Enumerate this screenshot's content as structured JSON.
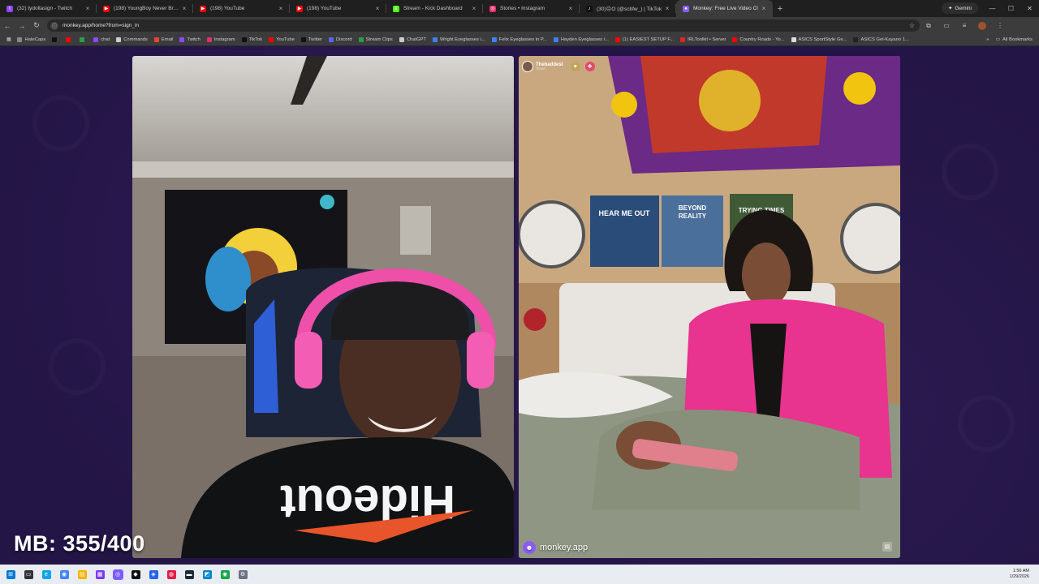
{
  "browser": {
    "tabs": [
      {
        "title": "(32) tydollasign - Twitch",
        "color": "#9146ff",
        "glyph": "t"
      },
      {
        "title": "(198) YoungBoy Never Broke A",
        "color": "#ff0000",
        "glyph": "▶"
      },
      {
        "title": "(198) YouTube",
        "color": "#ff0000",
        "glyph": "▶"
      },
      {
        "title": "(198) YouTube",
        "color": "#ff0000",
        "glyph": "▶"
      },
      {
        "title": "Stream - Kick Dashboard",
        "color": "#53fc18",
        "glyph": "k"
      },
      {
        "title": "Stories • Instagram",
        "color": "#e1306c",
        "glyph": "◎"
      },
      {
        "title": "(30)☹O (@scbfw_) | TikTok",
        "color": "#111111",
        "glyph": "♪"
      },
      {
        "title": "Monkey: Free Live Video Cl",
        "color": "#8b5cf6",
        "glyph": "●",
        "active": true
      }
    ],
    "new_tab": "+",
    "gemini_label": "Gemini",
    "address": "monkey.app/home?from=sign_in",
    "bookmarks": [
      {
        "label": "HateCaps",
        "color": "#888"
      },
      {
        "label": "",
        "color": "#111"
      },
      {
        "label": "",
        "color": "#ff0000"
      },
      {
        "label": "",
        "color": "#2a9d4a"
      },
      {
        "label": "chat",
        "color": "#9146ff"
      },
      {
        "label": "Commands",
        "color": "#ccc"
      },
      {
        "label": "Email",
        "color": "#ea4335"
      },
      {
        "label": "Twitch",
        "color": "#9146ff"
      },
      {
        "label": "Instagram",
        "color": "#e1306c"
      },
      {
        "label": "TikTok",
        "color": "#111"
      },
      {
        "label": "YouTube",
        "color": "#ff0000"
      },
      {
        "label": "Twitter",
        "color": "#111"
      },
      {
        "label": "Discord",
        "color": "#5865f2"
      },
      {
        "label": "Stream Clips",
        "color": "#2a9d4a"
      },
      {
        "label": "ChatGPT",
        "color": "#ccc"
      },
      {
        "label": "Wright Eyeglasses i...",
        "color": "#3b82f6"
      },
      {
        "label": "Felix Eyeglasses in P...",
        "color": "#3b82f6"
      },
      {
        "label": "Hayden Eyeglasses i...",
        "color": "#3b82f6"
      },
      {
        "label": "(1) EASIEST SETUP F...",
        "color": "#ff0000"
      },
      {
        "label": "IRLToolkit • Server",
        "color": "#dc2626"
      },
      {
        "label": "Country Roads - Yo...",
        "color": "#ff0000"
      },
      {
        "label": "ASICS SportStyle Ge...",
        "color": "#ddd"
      },
      {
        "label": "ASICS Gel-Kayano 1...",
        "color": "#222"
      }
    ],
    "all_bookmarks": "All Bookmarks"
  },
  "call": {
    "partner_username": "Thebaddest",
    "partner_location": "Texas",
    "brand": "monkey.app"
  },
  "overlay": {
    "mb_counter": "MB: 355/400"
  },
  "taskbar": {
    "icons": [
      {
        "name": "start-icon",
        "color": "#0078d4",
        "glyph": "⊞"
      },
      {
        "name": "taskview-icon",
        "color": "#333",
        "glyph": "▭"
      },
      {
        "name": "edge-icon",
        "color": "#0ea5e9",
        "glyph": "e"
      },
      {
        "name": "chrome-icon",
        "color": "#4285f4",
        "glyph": "◉"
      },
      {
        "name": "explorer-icon",
        "color": "#f5b400",
        "glyph": "▤"
      },
      {
        "name": "app-icon",
        "color": "#7c3aed",
        "glyph": "▦"
      },
      {
        "name": "obs-icon",
        "color": "#7b5cff",
        "glyph": "◎",
        "active": true
      },
      {
        "name": "app2-icon",
        "color": "#111",
        "glyph": "◆"
      },
      {
        "name": "app3-icon",
        "color": "#2563eb",
        "glyph": "◈"
      },
      {
        "name": "app4-icon",
        "color": "#e11d48",
        "glyph": "◍"
      },
      {
        "name": "terminal-icon",
        "color": "#1f2937",
        "glyph": "▬"
      },
      {
        "name": "app5-icon",
        "color": "#0284c7",
        "glyph": "◩"
      },
      {
        "name": "chrome2-icon",
        "color": "#16a34a",
        "glyph": "◉"
      },
      {
        "name": "settings-icon",
        "color": "#6b7280",
        "glyph": "⚙"
      }
    ],
    "time": "1:56 AM",
    "date": "1/29/2026"
  }
}
